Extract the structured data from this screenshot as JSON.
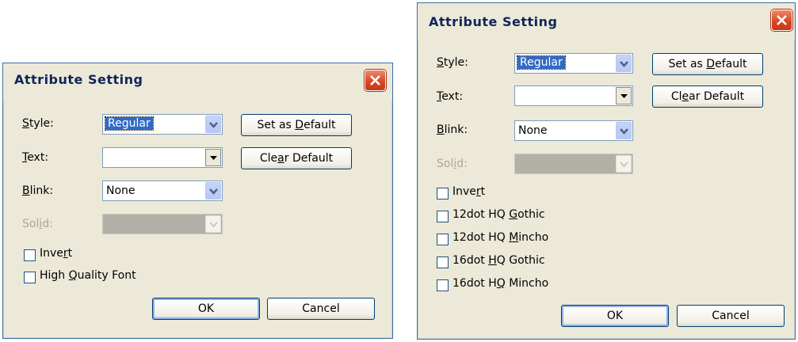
{
  "dialog1": {
    "title": "Attribute Setting",
    "style": {
      "label_pre": "",
      "label_u": "S",
      "label_post": "tyle:",
      "value": "Regular"
    },
    "text": {
      "label_pre": "",
      "label_u": "T",
      "label_post": "ext:",
      "value": ""
    },
    "blink": {
      "label_pre": "",
      "label_u": "B",
      "label_post": "link:",
      "value": "None"
    },
    "solid": {
      "label_pre": "Sol",
      "label_u": "i",
      "label_post": "d:",
      "value": ""
    },
    "set_default": {
      "pre": "Set as ",
      "u": "D",
      "post": "efault"
    },
    "clear_default": {
      "pre": "Cle",
      "u": "a",
      "post": "r Default"
    },
    "checkboxes": [
      {
        "pre": "Inve",
        "u": "r",
        "post": "t",
        "checked": false
      },
      {
        "pre": "High ",
        "u": "Q",
        "post": "uality Font",
        "checked": false
      }
    ],
    "ok": "OK",
    "cancel": "Cancel"
  },
  "dialog2": {
    "title": "Attribute Setting",
    "style": {
      "label_pre": "",
      "label_u": "S",
      "label_post": "tyle:",
      "value": "Regular"
    },
    "text": {
      "label_pre": "",
      "label_u": "T",
      "label_post": "ext:",
      "value": ""
    },
    "blink": {
      "label_pre": "",
      "label_u": "B",
      "label_post": "link:",
      "value": "None"
    },
    "solid": {
      "label_pre": "Sol",
      "label_u": "i",
      "label_post": "d:",
      "value": ""
    },
    "set_default": {
      "pre": "Set as ",
      "u": "D",
      "post": "efault"
    },
    "clear_default": {
      "pre": "Cl",
      "u": "e",
      "post": "ar Default"
    },
    "checkboxes": [
      {
        "pre": "Inve",
        "u": "r",
        "post": "t",
        "checked": false
      },
      {
        "pre": "12dot HQ ",
        "u": "G",
        "post": "othic",
        "checked": false
      },
      {
        "pre": "12dot HQ ",
        "u": "M",
        "post": "incho",
        "checked": false
      },
      {
        "pre": "16dot ",
        "u": "H",
        "post": "Q Gothic",
        "checked": false
      },
      {
        "pre": "16dot H",
        "u": "Q",
        "post": " Mincho",
        "checked": false
      }
    ],
    "ok": "OK",
    "cancel": "Cancel"
  },
  "colors": {
    "dialog_bg": "#ece9d8",
    "title_text": "#11245a",
    "close_button": "#d6451f",
    "selection": "#316ac5",
    "disabled_text": "#aca899"
  },
  "icons": {
    "close": "close-x-icon",
    "dropdown": "chevron-down-icon",
    "dropdown_plain": "triangle-down-icon"
  }
}
